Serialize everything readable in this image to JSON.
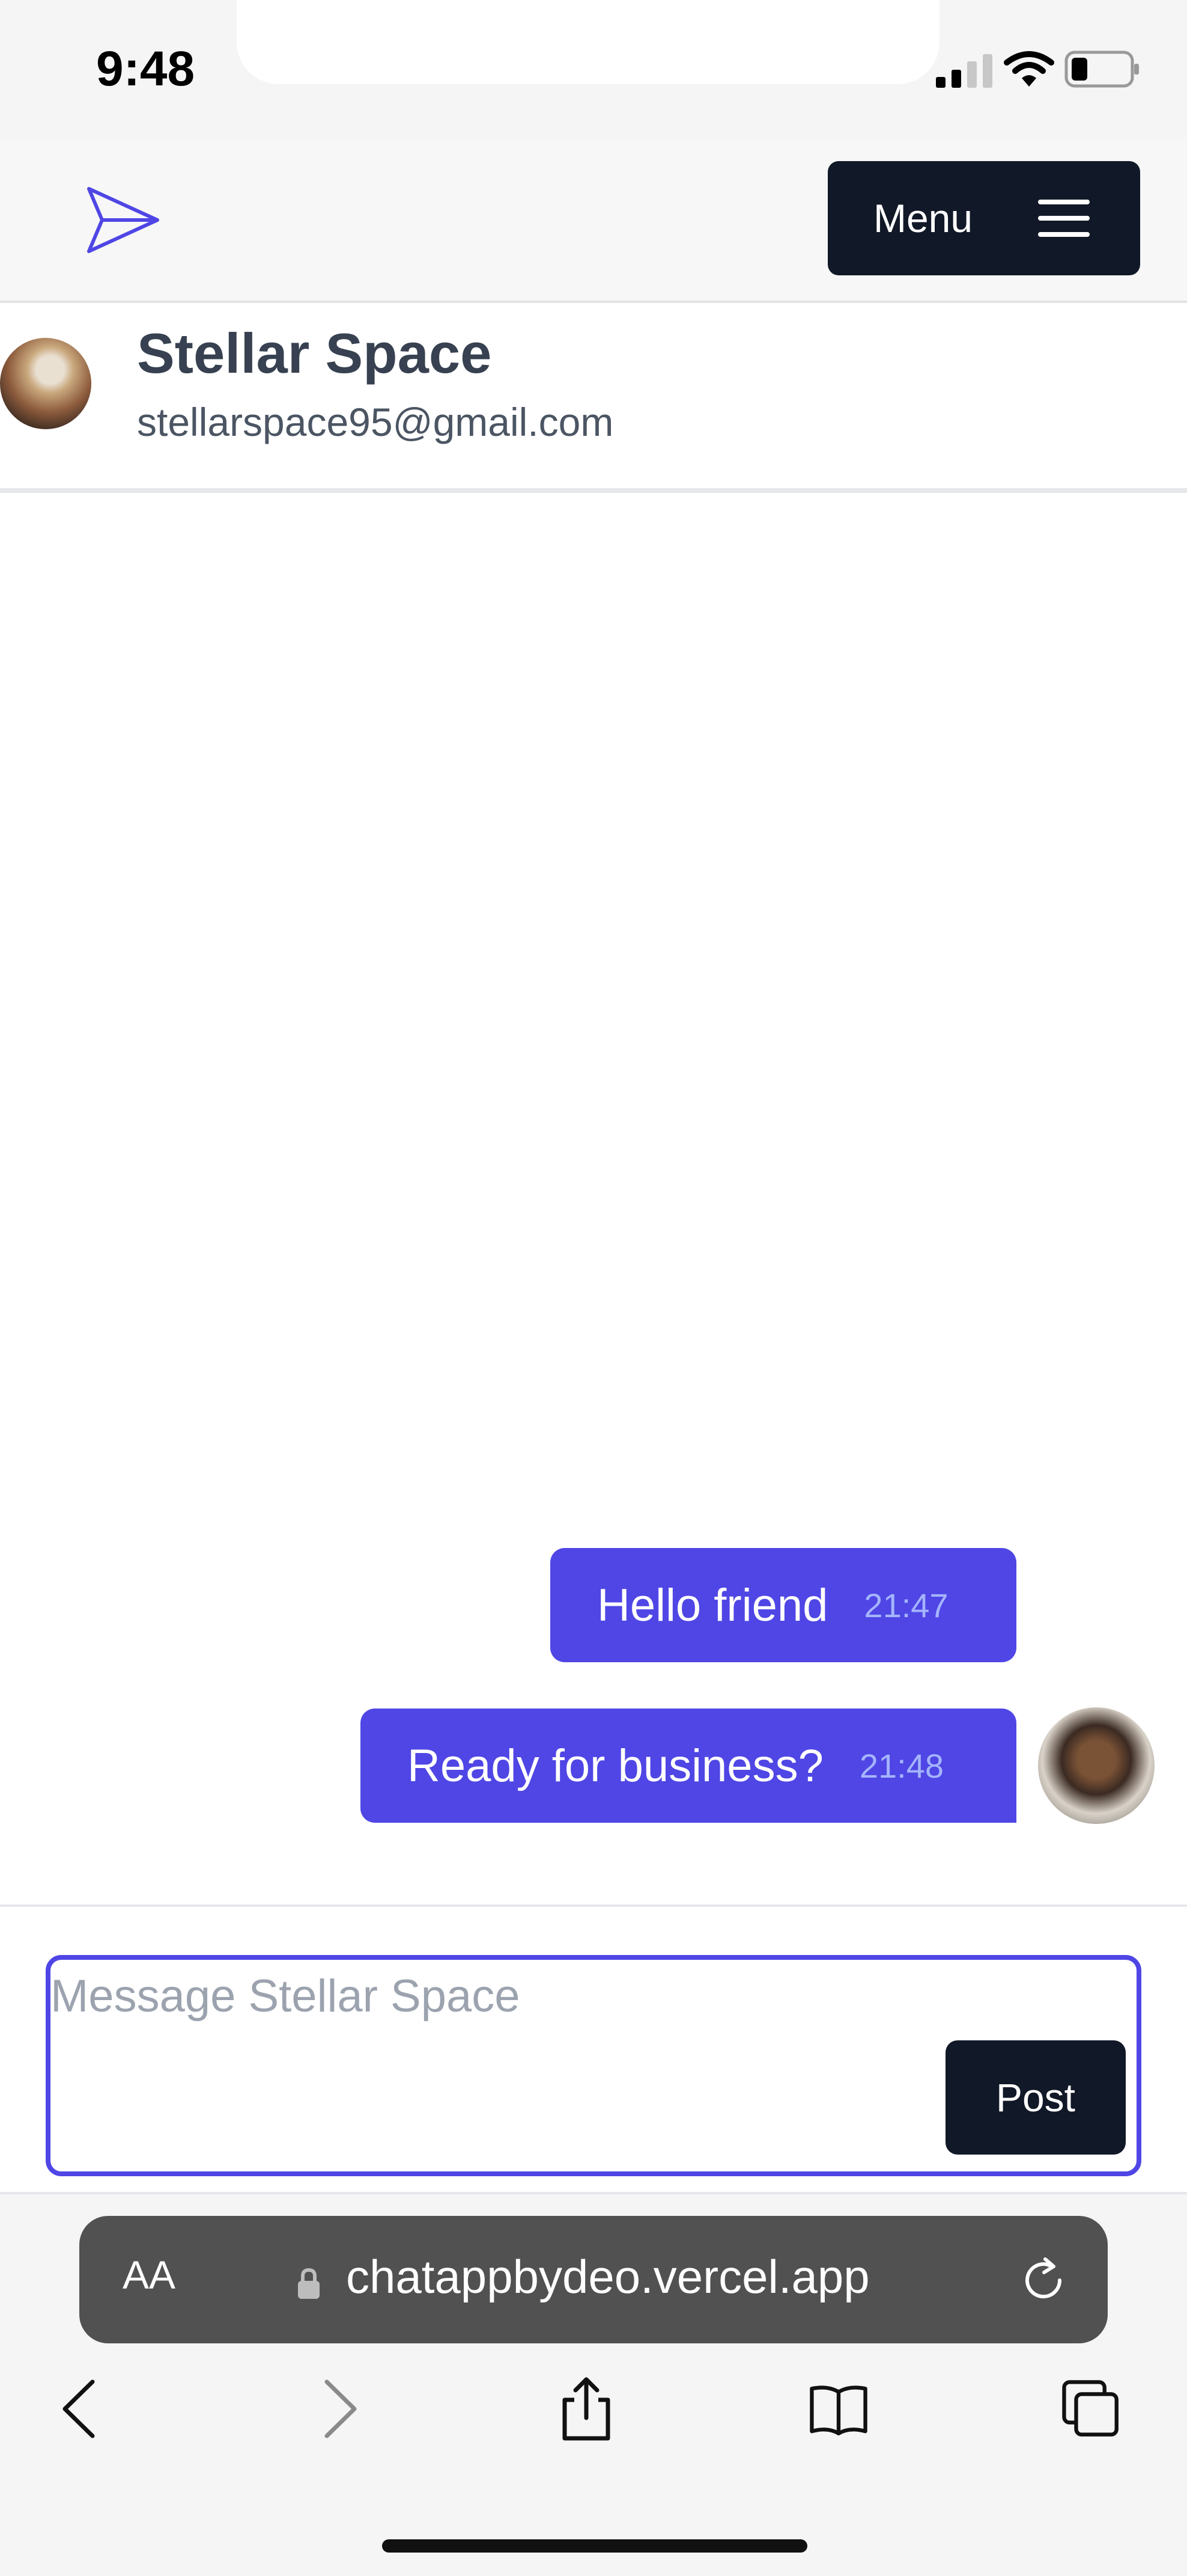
{
  "status_bar": {
    "time": "9:48",
    "signal_icon": "cellular-signal-icon",
    "wifi_icon": "wifi-icon",
    "battery_icon": "battery-icon"
  },
  "header": {
    "logo_icon": "paper-plane-icon",
    "menu_label": "Menu",
    "menu_icon": "hamburger-icon"
  },
  "contact": {
    "name": "Stellar Space",
    "email": "stellarspace95@gmail.com"
  },
  "messages": [
    {
      "text": "Hello friend",
      "time": "21:47"
    },
    {
      "text": "Ready for business?",
      "time": "21:48"
    }
  ],
  "composer": {
    "placeholder": "Message Stellar Space",
    "value": "",
    "post_label": "Post"
  },
  "browser": {
    "text_size_label": "AA",
    "url": "chatappbydeo.vercel.app",
    "toolbar": [
      "back-icon",
      "forward-icon",
      "share-icon",
      "bookmarks-icon",
      "tabs-icon"
    ]
  },
  "colors": {
    "accent": "#4f46e5",
    "dark_button": "#111827",
    "timestamp": "#a5b4fc"
  }
}
